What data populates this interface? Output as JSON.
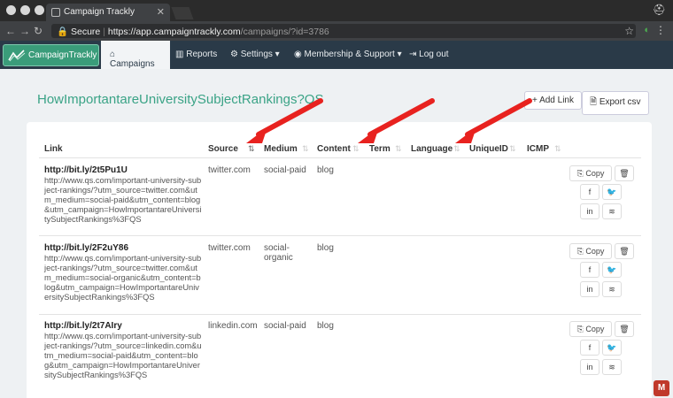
{
  "browser": {
    "tab_title": "Campaign Trackly",
    "secure_label": "Secure",
    "url_host": "https://app.campaigntrackly.com",
    "url_path": "/campaigns/?id=3786"
  },
  "nav": {
    "logo_text": "CampaignTrackly",
    "items": [
      {
        "icon": "home-icon",
        "label": "Campaigns"
      },
      {
        "icon": "bar-chart-icon",
        "label": "Reports"
      },
      {
        "icon": "gears-icon",
        "label": "Settings ▾"
      },
      {
        "icon": "user-circle-icon",
        "label": "Membership & Support ▾"
      },
      {
        "icon": "logout-icon",
        "label": "Log out"
      }
    ]
  },
  "page": {
    "title": "HowImportantareUniversitySubjectRankings?QS",
    "add_link_label": "+ Add Link",
    "export_label": "Export csv"
  },
  "table": {
    "columns": [
      "Link",
      "Source",
      "Medium",
      "Content",
      "Term",
      "Language",
      "UniqueID",
      "ICMP"
    ],
    "rows": [
      {
        "short": "http://bit.ly/2t5Pu1U",
        "long": "http://www.qs.com/important-university-subject-rankings/?utm_source=twitter.com&utm_medium=social-paid&utm_content=blog&utm_campaign=HowImportantareUniversitySubjectRankings%3FQS",
        "source": "twitter.com",
        "medium": "social-paid",
        "content": "blog"
      },
      {
        "short": "http://bit.ly/2F2uY86",
        "long": "http://www.qs.com/important-university-subject-rankings/?utm_source=twitter.com&utm_medium=social-organic&utm_content=blog&utm_campaign=HowImportantareUniversitySubjectRankings%3FQS",
        "source": "twitter.com",
        "medium": "social-organic",
        "content": "blog"
      },
      {
        "short": "http://bit.ly/2t7AIry",
        "long": "http://www.qs.com/important-university-subject-rankings/?utm_source=linkedin.com&utm_medium=social-paid&utm_content=blog&utm_campaign=HowImportantareUniversitySubjectRankings%3FQS",
        "source": "linkedin.com",
        "medium": "social-paid",
        "content": "blog"
      }
    ],
    "actions": {
      "copy_label": "Copy",
      "facebook": "f",
      "linkedin": "in"
    }
  },
  "colors": {
    "accent": "#3aa386",
    "nav_bg": "#2a3a48",
    "arrow": "#e8221f"
  }
}
